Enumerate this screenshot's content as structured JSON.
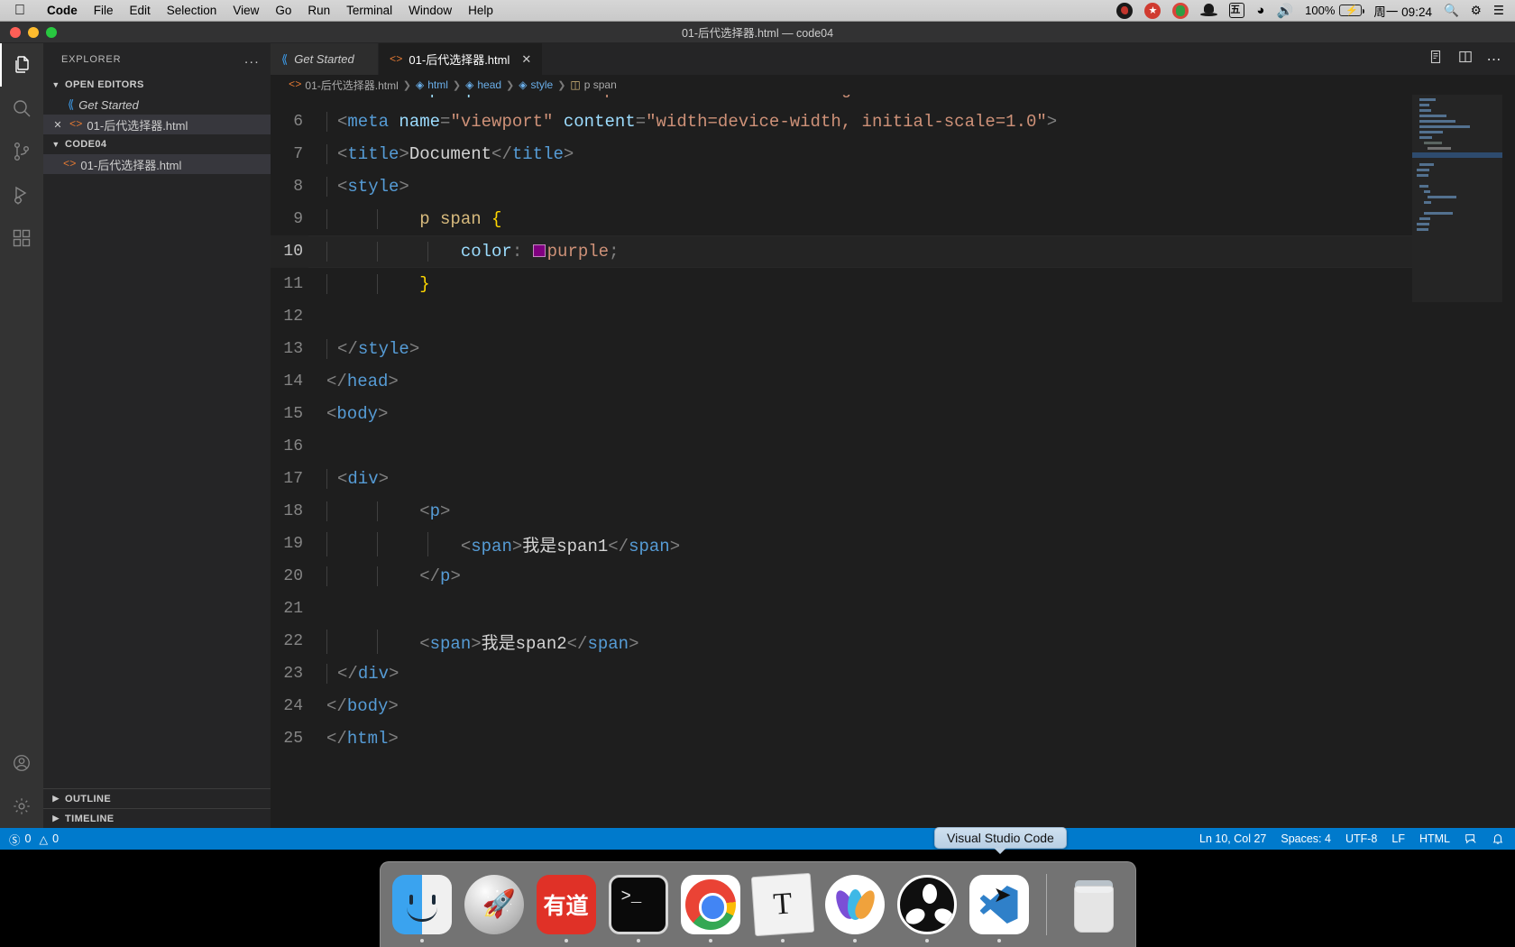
{
  "menubar": {
    "apple_icon": "apple-logo",
    "items": [
      {
        "label": "Code",
        "bold": true
      },
      {
        "label": "File",
        "bold": false
      },
      {
        "label": "Edit",
        "bold": false
      },
      {
        "label": "Selection",
        "bold": false
      },
      {
        "label": "View",
        "bold": false
      },
      {
        "label": "Go",
        "bold": false
      },
      {
        "label": "Run",
        "bold": false
      },
      {
        "label": "Terminal",
        "bold": false
      },
      {
        "label": "Window",
        "bold": false
      },
      {
        "label": "Help",
        "bold": false
      }
    ],
    "status_icons": [
      "obs-icon",
      "recorder-icon",
      "snipaste-icon",
      "bartender-icon",
      "ime-icon",
      "wifi-icon",
      "volume-icon"
    ],
    "ime_glyph": "五",
    "battery_percent": "100%",
    "clock": "周一 09:24",
    "spotlight_icon": "search-icon",
    "controlcenter_icon": "control-center-icon",
    "notifications_icon": "list-icon"
  },
  "window": {
    "title": "01-后代选择器.html — code04",
    "traffic_lights": [
      "close",
      "minimize",
      "zoom"
    ]
  },
  "activitybar": {
    "items": [
      {
        "name": "explorer",
        "icon": "files-icon",
        "active": true
      },
      {
        "name": "search",
        "icon": "search-icon",
        "active": false
      },
      {
        "name": "source-control",
        "icon": "source-control-icon",
        "active": false
      },
      {
        "name": "run-and-debug",
        "icon": "debug-icon",
        "active": false
      },
      {
        "name": "extensions",
        "icon": "extensions-icon",
        "active": false
      }
    ],
    "bottom_items": [
      {
        "name": "accounts",
        "icon": "account-icon"
      },
      {
        "name": "manage",
        "icon": "gear-icon"
      }
    ]
  },
  "sidebar": {
    "header": "EXPLORER",
    "more_actions": "...",
    "open_editors": {
      "label": "OPEN EDITORS",
      "expanded": true,
      "items": [
        {
          "label": "Get Started",
          "icon": "vscode-icon",
          "italic": true,
          "selected": false,
          "has_close": false
        },
        {
          "label": "01-后代选择器.html",
          "icon": "html-icon",
          "italic": false,
          "selected": true,
          "has_close": true
        }
      ]
    },
    "folder": {
      "label": "CODE04",
      "expanded": true,
      "items": [
        {
          "label": "01-后代选择器.html",
          "icon": "html-icon",
          "selected": true
        }
      ]
    },
    "outline": "OUTLINE",
    "timeline": "TIMELINE"
  },
  "tabs": [
    {
      "label": "Get Started",
      "icon": "vscode-icon",
      "active": false,
      "italic": true,
      "closable": false
    },
    {
      "label": "01-后代选择器.html",
      "icon": "html-icon",
      "active": true,
      "italic": false,
      "closable": true,
      "close_label": "✕"
    }
  ],
  "editor_actions": [
    {
      "name": "open-preview",
      "icon": "preview-icon"
    },
    {
      "name": "split-editor",
      "icon": "split-editor-icon"
    },
    {
      "name": "more-actions",
      "icon": "ellipsis-icon"
    }
  ],
  "breadcrumbs": [
    {
      "label": "01-后代选择器.html",
      "icon": "html-icon"
    },
    {
      "label": "html",
      "icon": "symbol-field-icon"
    },
    {
      "label": "head",
      "icon": "symbol-field-icon"
    },
    {
      "label": "style",
      "icon": "symbol-field-icon"
    },
    {
      "label": "p span",
      "icon": "symbol-ruler-icon"
    }
  ],
  "code": {
    "language": "HTML",
    "current_line": 10,
    "lines": [
      {
        "n": 6,
        "indent": 1,
        "text": "<meta name=\"viewport\" content=\"width=device-width, initial-scale=1.0\">"
      },
      {
        "n": 7,
        "indent": 1,
        "text": "<title>Document</title>"
      },
      {
        "n": 8,
        "indent": 1,
        "text": "<style>"
      },
      {
        "n": 9,
        "indent": 2,
        "text": "p span {"
      },
      {
        "n": 10,
        "indent": 3,
        "text": "color: purple;"
      },
      {
        "n": 11,
        "indent": 2,
        "text": "}"
      },
      {
        "n": 12,
        "indent": 0,
        "text": ""
      },
      {
        "n": 13,
        "indent": 1,
        "text": "</style>"
      },
      {
        "n": 14,
        "indent": 0,
        "text": "</head>"
      },
      {
        "n": 15,
        "indent": 0,
        "text": "<body>"
      },
      {
        "n": 16,
        "indent": 0,
        "text": ""
      },
      {
        "n": 17,
        "indent": 1,
        "text": "<div>"
      },
      {
        "n": 18,
        "indent": 2,
        "text": "<p>"
      },
      {
        "n": 19,
        "indent": 3,
        "text": "<span>我是span1</span>"
      },
      {
        "n": 20,
        "indent": 2,
        "text": "</p>"
      },
      {
        "n": 21,
        "indent": 0,
        "text": ""
      },
      {
        "n": 22,
        "indent": 2,
        "text": "<span>我是span2</span>"
      },
      {
        "n": 23,
        "indent": 1,
        "text": "</div>"
      },
      {
        "n": 24,
        "indent": 0,
        "text": "</body>"
      },
      {
        "n": 25,
        "indent": 0,
        "text": "</html>"
      }
    ],
    "color_swatch": "#800080"
  },
  "statusbar": {
    "errors_icon": "error-icon",
    "errors": "0",
    "warnings_icon": "warning-icon",
    "warnings": "0",
    "position": "Ln 10, Col 27",
    "indentation": "Spaces: 4",
    "encoding": "UTF-8",
    "eol": "LF",
    "language": "HTML",
    "feedback_icon": "feedback-icon",
    "bell_icon": "bell-icon"
  },
  "tooltip": {
    "text": "Visual Studio Code"
  },
  "dock": {
    "items": [
      {
        "name": "finder",
        "label": "Finder",
        "running": true
      },
      {
        "name": "launchpad",
        "label": "Launchpad",
        "running": false
      },
      {
        "name": "youdao-dictionary",
        "label": "有道",
        "glyph": "有道",
        "running": true
      },
      {
        "name": "terminal",
        "label": "Terminal",
        "running": true
      },
      {
        "name": "google-chrome",
        "label": "Google Chrome",
        "running": true
      },
      {
        "name": "typora",
        "label": "Typora",
        "glyph": "T",
        "running": true
      },
      {
        "name": "lightroom",
        "label": "Lightroom",
        "running": true
      },
      {
        "name": "obs-studio",
        "label": "OBS",
        "running": true
      },
      {
        "name": "visual-studio-code",
        "label": "Visual Studio Code",
        "running": true
      }
    ],
    "trash": {
      "name": "trash",
      "label": "Trash"
    }
  }
}
